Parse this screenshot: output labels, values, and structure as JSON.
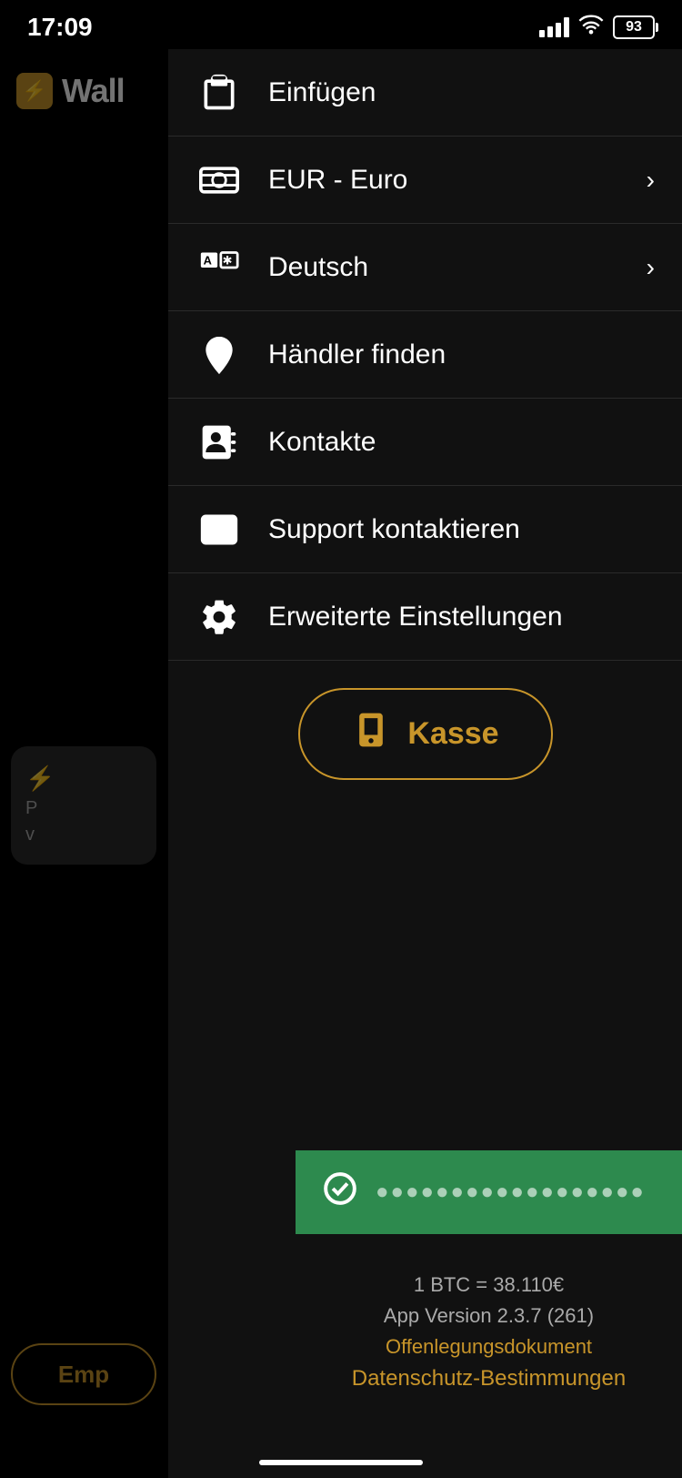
{
  "status_bar": {
    "time": "17:09",
    "battery": "93"
  },
  "wallet": {
    "title": "Wall",
    "bolt_symbol": "⚡"
  },
  "menu": {
    "items": [
      {
        "id": "einfuegen",
        "label": "Einfügen",
        "icon": "paste-icon",
        "has_chevron": false
      },
      {
        "id": "eur-euro",
        "label": "EUR - Euro",
        "icon": "currency-icon",
        "has_chevron": true
      },
      {
        "id": "deutsch",
        "label": "Deutsch",
        "icon": "language-icon",
        "has_chevron": true
      },
      {
        "id": "haendler-finden",
        "label": "Händler finden",
        "icon": "location-icon",
        "has_chevron": false
      },
      {
        "id": "kontakte",
        "label": "Kontakte",
        "icon": "contacts-icon",
        "has_chevron": false
      },
      {
        "id": "support",
        "label": "Support kontaktieren",
        "icon": "mail-icon",
        "has_chevron": false
      },
      {
        "id": "einstellungen",
        "label": "Erweiterte Einstellungen",
        "icon": "settings-icon",
        "has_chevron": false
      }
    ],
    "kasse_label": "Kasse"
  },
  "green_banner": {
    "blurred_text": "••••••••••••••••••"
  },
  "footer": {
    "btc_rate": "1 BTC = 38.110€",
    "app_version": "App Version 2.3.7 (261)",
    "disclosure": "Offenlegungsdokument",
    "privacy": "Datenschutz-Bestimmungen"
  },
  "left_card": {
    "text_line1": "P",
    "text_line2": "v"
  },
  "bottom_btn": "Emp"
}
